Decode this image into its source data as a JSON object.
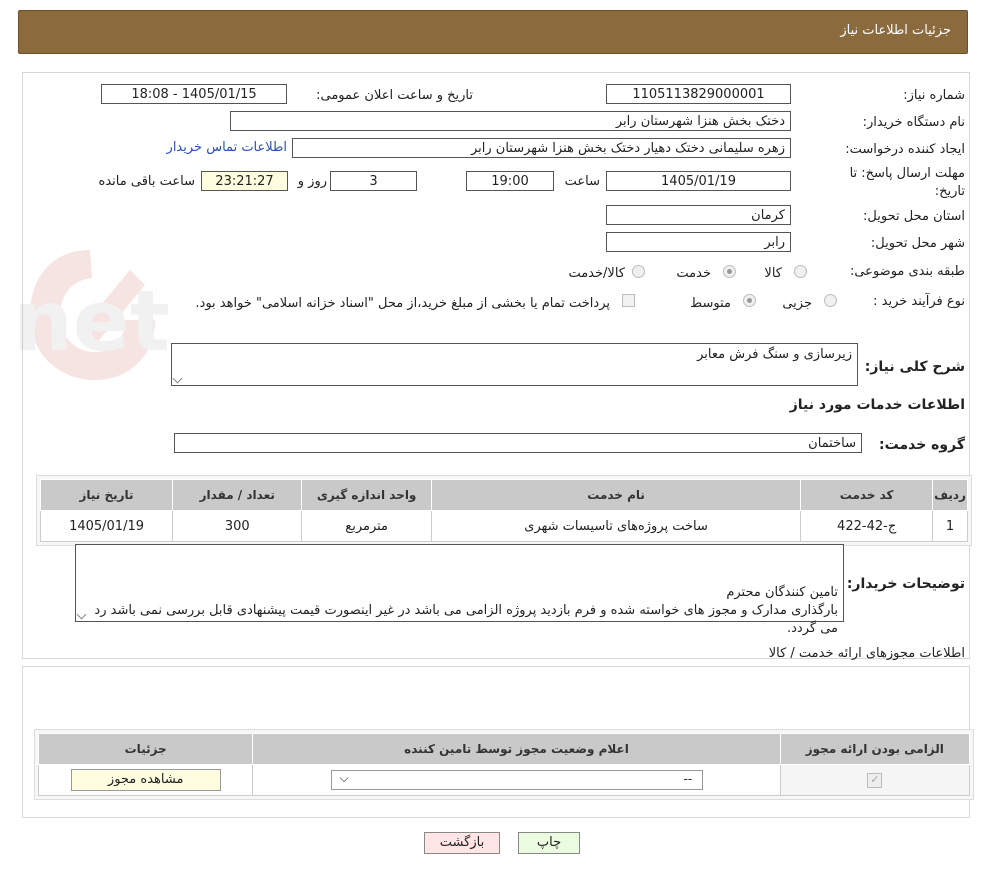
{
  "header": {
    "title": "جزئیات اطلاعات نیاز"
  },
  "form": {
    "need_number_label": "شماره نیاز:",
    "need_number": "1105113829000001",
    "announce_datetime_label": "تاریخ و ساعت اعلان عمومی:",
    "announce_datetime": "1405/01/15 - 18:08",
    "buyer_org_label": "نام دستگاه خریدار:",
    "buyer_org": "دختک بخش هنزا شهرستان رابر",
    "requester_label": "ایجاد کننده درخواست:",
    "requester": "زهره سلیمانی دختک دهیار دختک بخش هنزا شهرستان رابر",
    "contact_link": "اطلاعات تماس خریدار",
    "deadline_label_line1": "مهلت ارسال پاسخ: تا",
    "deadline_label_line2": "تاریخ:",
    "deadline_date": "1405/01/19",
    "time_label": "ساعت",
    "deadline_time": "19:00",
    "days_value": "3",
    "days_label": "روز و",
    "remaining_time": "23:21:27",
    "remaining_label": "ساعت باقی مانده",
    "province_label": "استان محل تحویل:",
    "province": "کرمان",
    "city_label": "شهر محل تحویل:",
    "city": "رابر",
    "category_label": "طبقه بندی موضوعی:",
    "category_options": [
      "کالا",
      "خدمت",
      "کالا/خدمت"
    ],
    "category_selected": "خدمت",
    "purchase_type_label": "نوع فرآیند خرید :",
    "purchase_type_options": [
      "جزیی",
      "متوسط"
    ],
    "purchase_type_selected": "متوسط",
    "payment_note": "پرداخت تمام یا بخشی از مبلغ خرید،از محل \"اسناد خزانه اسلامی\" خواهد بود.",
    "summary_label": "شرح کلی نیاز:",
    "summary": "زیرسازی و سنگ فرش معابر",
    "services_section_title": "اطلاعات خدمات مورد نیاز",
    "service_group_label": "گروه خدمت:",
    "service_group": "ساختمان",
    "buyer_notes_label": "توضیحات خریدار:",
    "buyer_notes": "تامین کنندگان محترم\nبارگذاری مدارک و مجوز های خواسته شده و فرم بازدید پروژه الزامی می باشد در غیر اینصورت قیمت پیشنهادی قابل بررسی نمی باشد رد می گردد."
  },
  "services_table": {
    "headers": [
      "ردیف",
      "کد خدمت",
      "نام خدمت",
      "واحد اندازه گیری",
      "تعداد / مقدار",
      "تاریخ نیاز"
    ],
    "rows": [
      [
        "1",
        "ج-42-422",
        "ساخت پروژه‌های تاسیسات شهری",
        "مترمربع",
        "300",
        "1405/01/19"
      ]
    ]
  },
  "permits": {
    "section_title": "اطلاعات مجوزهای ارائه خدمت / کالا",
    "headers": [
      "الزامی بودن ارائه مجوز",
      "اعلام وضعیت مجوز توسط تامین کننده",
      "جزئیات"
    ],
    "select_value": "--",
    "view_button": "مشاهده مجوز"
  },
  "footer": {
    "back_button": "بازگشت",
    "print_button": "چاپ"
  },
  "watermark": {
    "text": "AriaTender.net"
  }
}
